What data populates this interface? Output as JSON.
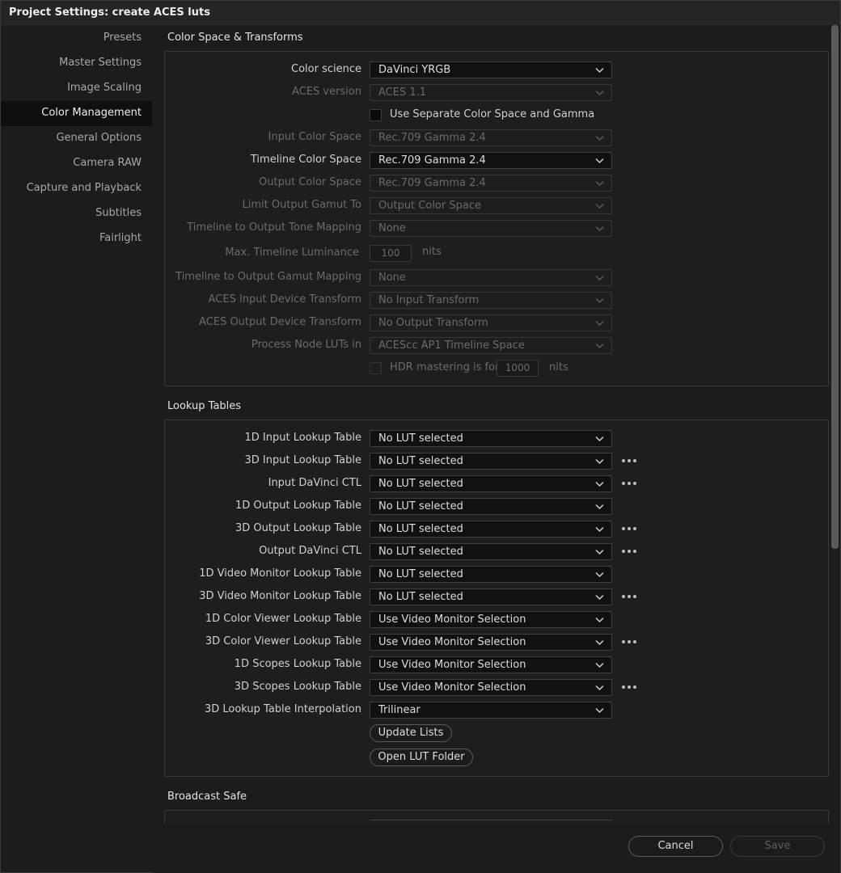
{
  "window": {
    "title": "Project Settings:  create ACES luts"
  },
  "sidebar": {
    "items": [
      {
        "label": "Presets"
      },
      {
        "label": "Master Settings"
      },
      {
        "label": "Image Scaling"
      },
      {
        "label": "Color Management"
      },
      {
        "label": "General Options"
      },
      {
        "label": "Camera RAW"
      },
      {
        "label": "Capture and Playback"
      },
      {
        "label": "Subtitles"
      },
      {
        "label": "Fairlight"
      }
    ],
    "active": "Color Management"
  },
  "color_space": {
    "title": "Color Space & Transforms",
    "color_science": {
      "label": "Color science",
      "value": "DaVinci YRGB"
    },
    "aces_version": {
      "label": "ACES version",
      "value": "ACES 1.1"
    },
    "separate_gamma": {
      "label": "Use Separate Color Space and Gamma",
      "checked": false
    },
    "input_color_space": {
      "label": "Input Color Space",
      "value": "Rec.709 Gamma 2.4"
    },
    "timeline_color_space": {
      "label": "Timeline Color Space",
      "value": "Rec.709 Gamma 2.4"
    },
    "output_color_space": {
      "label": "Output Color Space",
      "value": "Rec.709 Gamma 2.4"
    },
    "limit_output_gamut": {
      "label": "Limit Output Gamut To",
      "value": "Output Color Space"
    },
    "tone_mapping": {
      "label": "Timeline to Output Tone Mapping",
      "value": "None"
    },
    "max_luminance": {
      "label": "Max. Timeline Luminance",
      "value": "100",
      "unit": "nits"
    },
    "gamut_mapping": {
      "label": "Timeline to Output Gamut Mapping",
      "value": "None"
    },
    "aces_idt": {
      "label": "ACES Input Device Transform",
      "value": "No Input Transform"
    },
    "aces_odt": {
      "label": "ACES Output Device Transform",
      "value": "No Output Transform"
    },
    "process_node_luts": {
      "label": "Process Node LUTs in",
      "value": "ACEScc AP1 Timeline Space"
    },
    "hdr_mastering": {
      "label": "HDR mastering is for",
      "value": "1000",
      "unit": "nits",
      "checked": false
    }
  },
  "lookup_tables": {
    "title": "Lookup Tables",
    "rows": [
      {
        "label": "1D Input Lookup Table",
        "value": "No LUT selected"
      },
      {
        "label": "3D Input Lookup Table",
        "value": "No LUT selected"
      },
      {
        "label": "Input DaVinci CTL",
        "value": "No LUT selected"
      },
      {
        "label": "1D Output Lookup Table",
        "value": "No LUT selected"
      },
      {
        "label": "3D Output Lookup Table",
        "value": "No LUT selected"
      },
      {
        "label": "Output DaVinci CTL",
        "value": "No LUT selected"
      },
      {
        "label": "1D Video Monitor Lookup Table",
        "value": "No LUT selected"
      },
      {
        "label": "3D Video Monitor Lookup Table",
        "value": "No LUT selected"
      },
      {
        "label": "1D Color Viewer Lookup Table",
        "value": "Use Video Monitor Selection"
      },
      {
        "label": "3D Color Viewer Lookup Table",
        "value": "Use Video Monitor Selection"
      },
      {
        "label": "1D Scopes Lookup Table",
        "value": "Use Video Monitor Selection"
      },
      {
        "label": "3D Scopes Lookup Table",
        "value": "Use Video Monitor Selection"
      },
      {
        "label": "3D Lookup Table Interpolation",
        "value": "Trilinear"
      }
    ],
    "update_lists": "Update Lists",
    "open_lut_folder": "Open LUT Folder"
  },
  "broadcast_safe": {
    "title": "Broadcast Safe"
  },
  "footer": {
    "cancel": "Cancel",
    "save": "Save"
  },
  "icons": {
    "dropdown": "chevron-down-icon",
    "more": "more-options-icon"
  }
}
